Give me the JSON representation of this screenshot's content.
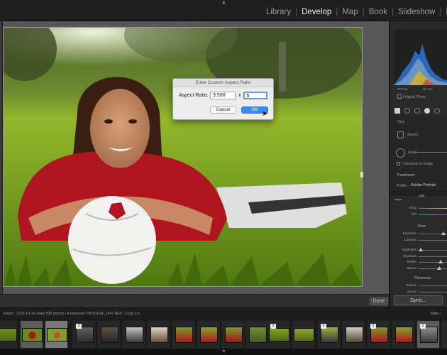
{
  "modules": {
    "items": [
      {
        "label": "Library"
      },
      {
        "label": "Develop",
        "active": true
      },
      {
        "label": "Map"
      },
      {
        "label": "Book"
      },
      {
        "label": "Slideshow"
      },
      {
        "label": "P"
      }
    ],
    "top_arrow": "▲"
  },
  "dialog": {
    "title": "Enter Custom Aspect Ratio",
    "aspect_label": "Aspect Ratio:",
    "width_value": "3.500",
    "separator": "x",
    "height_value": "5",
    "cancel_label": "Cancel",
    "ok_label": "OK"
  },
  "toolbar": {
    "done_label": "Done"
  },
  "right_panel": {
    "histogram": {
      "left_value": "ISO 80",
      "right_value": "1/8 sec"
    },
    "original_photo_label": "Original Photo",
    "crop": {
      "tool_label": "Tool",
      "aspect_label": "Aspect",
      "angle_label": "Angle",
      "constrain_label": "Constrain to Image"
    },
    "basic": {
      "treatment_label": "Treatment :",
      "profile_label": "Profile :",
      "profile_value": "Adobe Portrait",
      "wb_label": "WB :",
      "temp_label": "Temp",
      "tint_label": "Tint",
      "tone_label": "Tone",
      "exposure_label": "Exposure",
      "contrast_label": "Contrast",
      "highlights_label": "Highlights",
      "shadows_label": "Shadows",
      "whites_label": "Whites",
      "blacks_label": "Blacks",
      "presence_label": "Presence",
      "texture_label": "Texture",
      "clarity_label": "Clarity"
    },
    "sync_label": "Sync..."
  },
  "filmstrip": {
    "info": "Folder : 2018-10-14 Jules    508 photos / 4 selected / 20181014_1947.NEF / Copy 3  ▾",
    "filter_label": "Filter :",
    "stack_badges": [
      "2",
      "3",
      "2",
      "3",
      "2"
    ],
    "bottom_arrow": "▼"
  },
  "colors": {
    "accent": "#3d87f0",
    "grass": "#7ea21f",
    "jersey": "#b0141e",
    "panel": "#2a2a2a"
  }
}
